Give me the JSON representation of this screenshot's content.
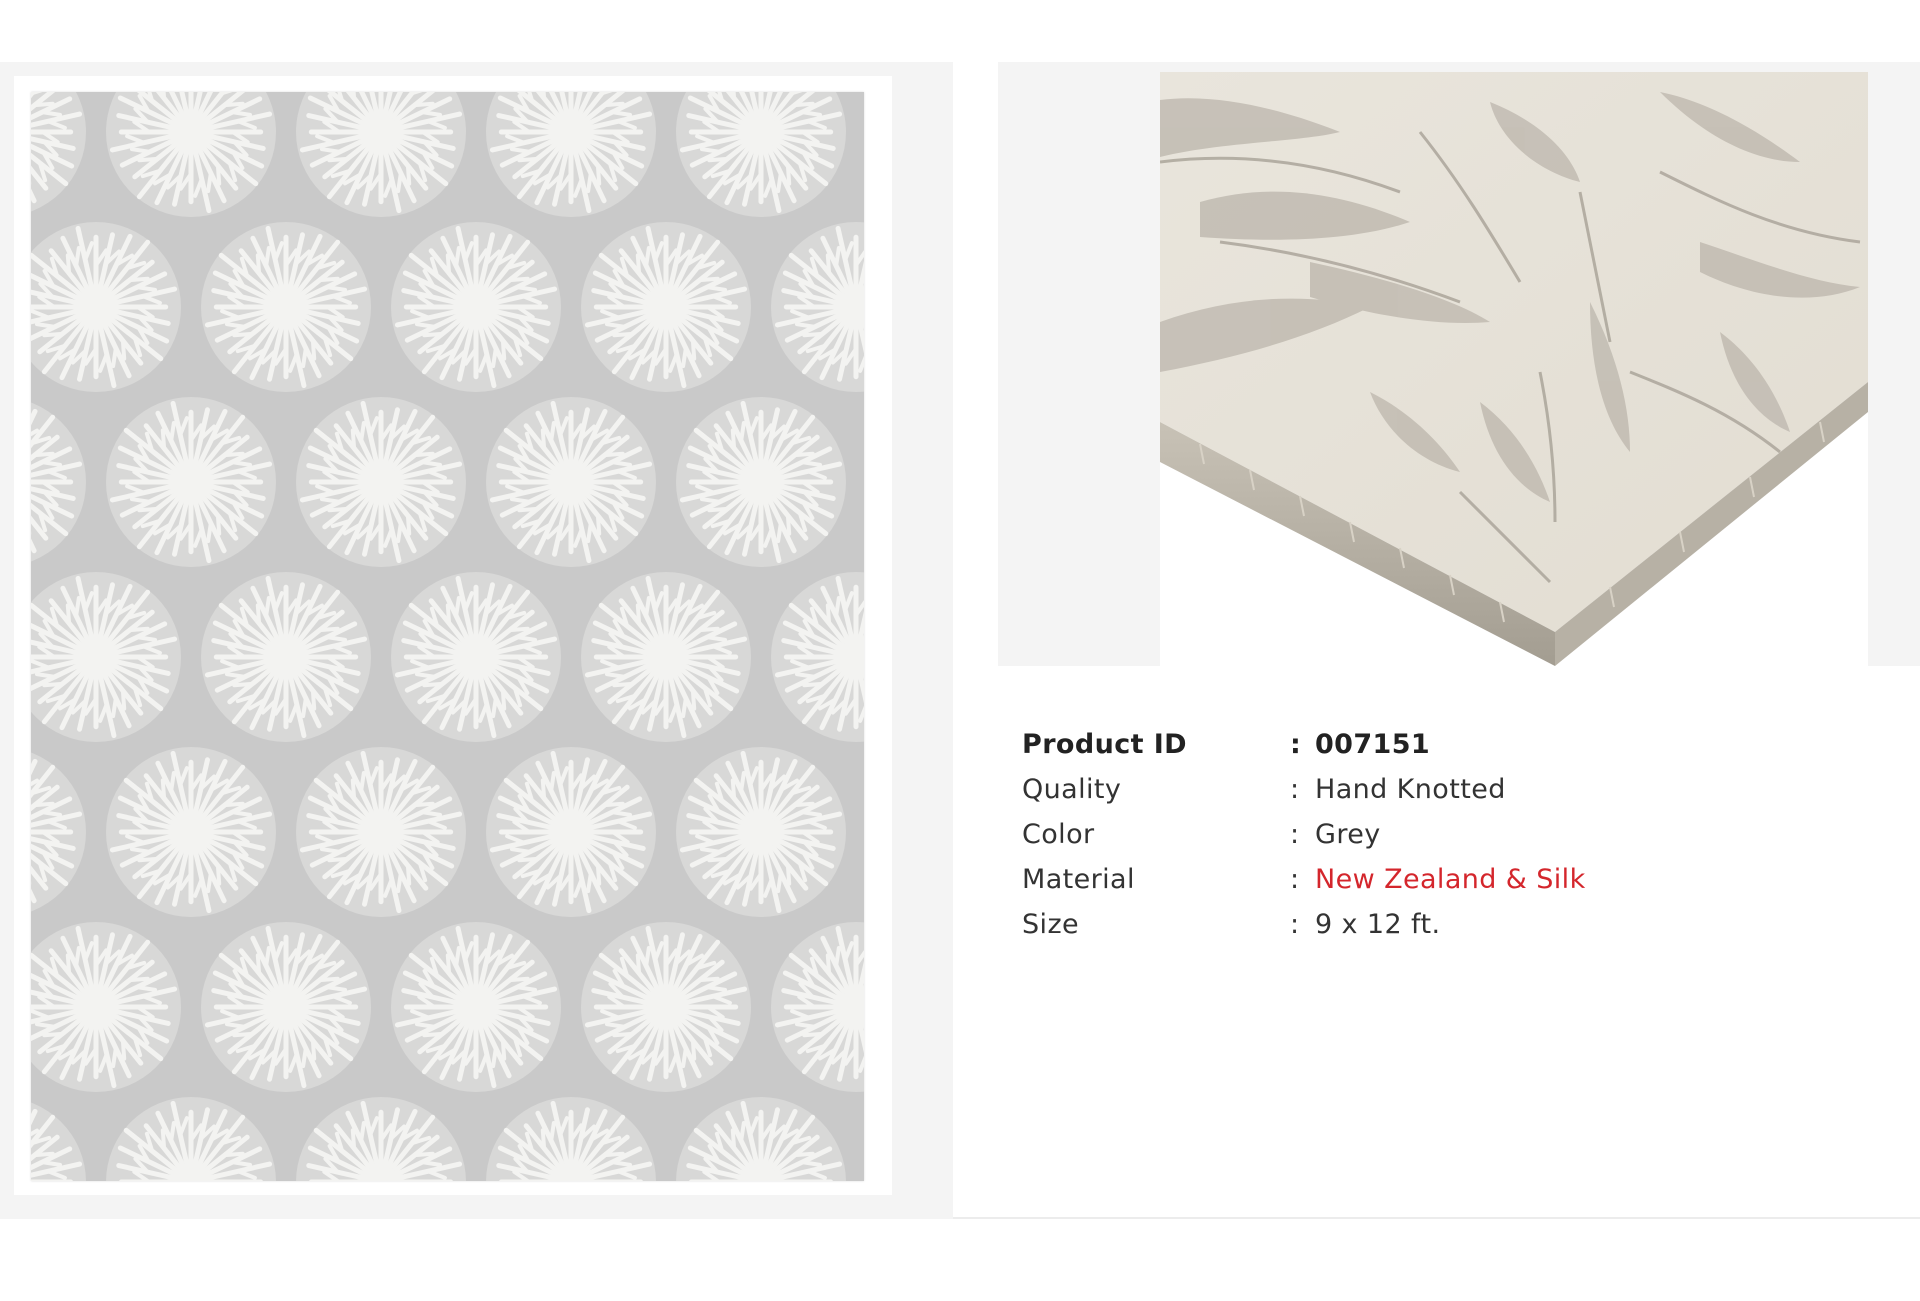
{
  "images": {
    "main": {
      "icon": "rug-photo",
      "colors": {
        "field": "#c9c9c9",
        "motif": "#f3f3f1"
      }
    },
    "detail": {
      "icon": "rug-corner-closeup-photo",
      "colors": {
        "pile": "#ece8df",
        "shadow": "#a9a49b"
      }
    }
  },
  "specs": [
    {
      "label": "Product ID",
      "separator": ":",
      "value": "007151",
      "bold": true,
      "accent": false
    },
    {
      "label": "Quality",
      "separator": ":",
      "value": "Hand Knotted",
      "bold": false,
      "accent": false
    },
    {
      "label": "Color",
      "separator": ":",
      "value": "Grey",
      "bold": false,
      "accent": false
    },
    {
      "label": "Material",
      "separator": ":",
      "value": "New Zealand & Silk",
      "bold": false,
      "accent": true
    },
    {
      "label": "Size",
      "separator": ":",
      "value": "9 x 12 ft.",
      "bold": false,
      "accent": false
    }
  ],
  "theme": {
    "accent": "#d4262c",
    "text": "#333333",
    "panel": "#f4f4f4"
  }
}
